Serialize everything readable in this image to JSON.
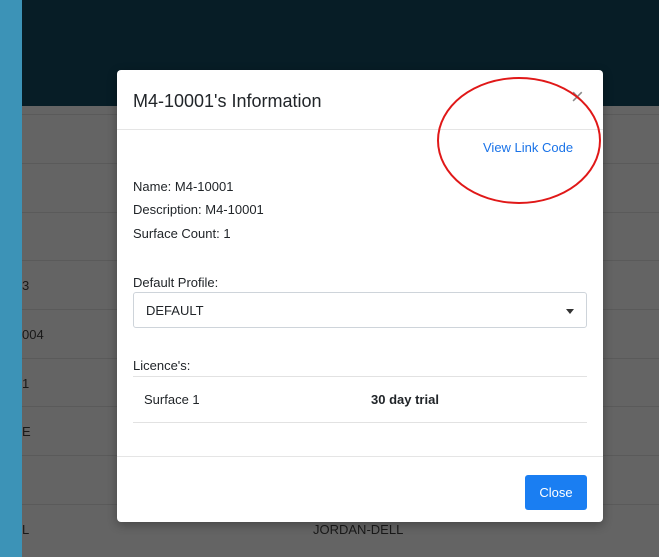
{
  "background": {
    "rows": [
      {
        "left": "",
        "right": ""
      },
      {
        "left": "",
        "right": ""
      },
      {
        "left": "3",
        "right": ""
      },
      {
        "left": "004",
        "right": ""
      },
      {
        "left": "1",
        "right": ""
      },
      {
        "left": "E",
        "right": ""
      },
      {
        "left": "",
        "right": ""
      },
      {
        "left": "L",
        "right": "JORDAN-DELL"
      }
    ]
  },
  "modal": {
    "title": "M4-10001's Information",
    "close_icon": "×",
    "view_link_code": "View Link Code",
    "info": {
      "name": "Name: M4-10001",
      "description": "Description: M4-10001",
      "surface_count": "Surface Count: 1"
    },
    "default_profile": {
      "label": "Default Profile:",
      "selected": "DEFAULT"
    },
    "licences": {
      "label": "Licence's:",
      "rows": [
        {
          "surface": "Surface 1",
          "status": "30 day trial"
        }
      ]
    },
    "close_button": "Close"
  },
  "colors": {
    "header": "#0f3a4d",
    "accent_link": "#1a73e8",
    "primary_button": "#1a7ef2",
    "annotation": "#e01818"
  }
}
